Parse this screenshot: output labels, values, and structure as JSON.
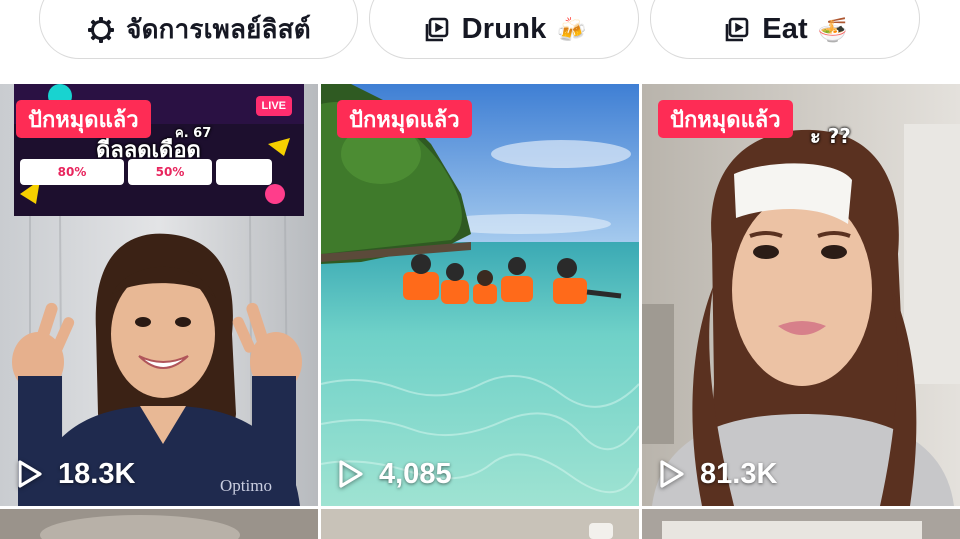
{
  "playlists": [
    {
      "label": "จัดการเพลย์ลิสต์",
      "icon": "gear-icon",
      "emoji": ""
    },
    {
      "label": "Drunk",
      "icon": "playlist-icon",
      "emoji": "🍻"
    },
    {
      "label": "Eat",
      "icon": "playlist-icon",
      "emoji": "🍜"
    }
  ],
  "videos": [
    {
      "pinned_label": "ปักหมุดแล้ว",
      "views": "18.3K",
      "promo": {
        "headline": "ดีลลดเดือด",
        "date_text": "ค. 67",
        "live": "LIVE",
        "tag_a": "80%",
        "tag_b": "50%"
      },
      "shirt_text": "Optimo"
    },
    {
      "pinned_label": "ปักหมุดแล้ว",
      "views": "4,085"
    },
    {
      "pinned_label": "ปักหมุดแล้ว",
      "views": "81.3K",
      "caption_end": "ะ ??"
    }
  ],
  "colors": {
    "pinned_badge": "#fe2c55",
    "chip_border": "#dadada",
    "text": "#161823"
  }
}
